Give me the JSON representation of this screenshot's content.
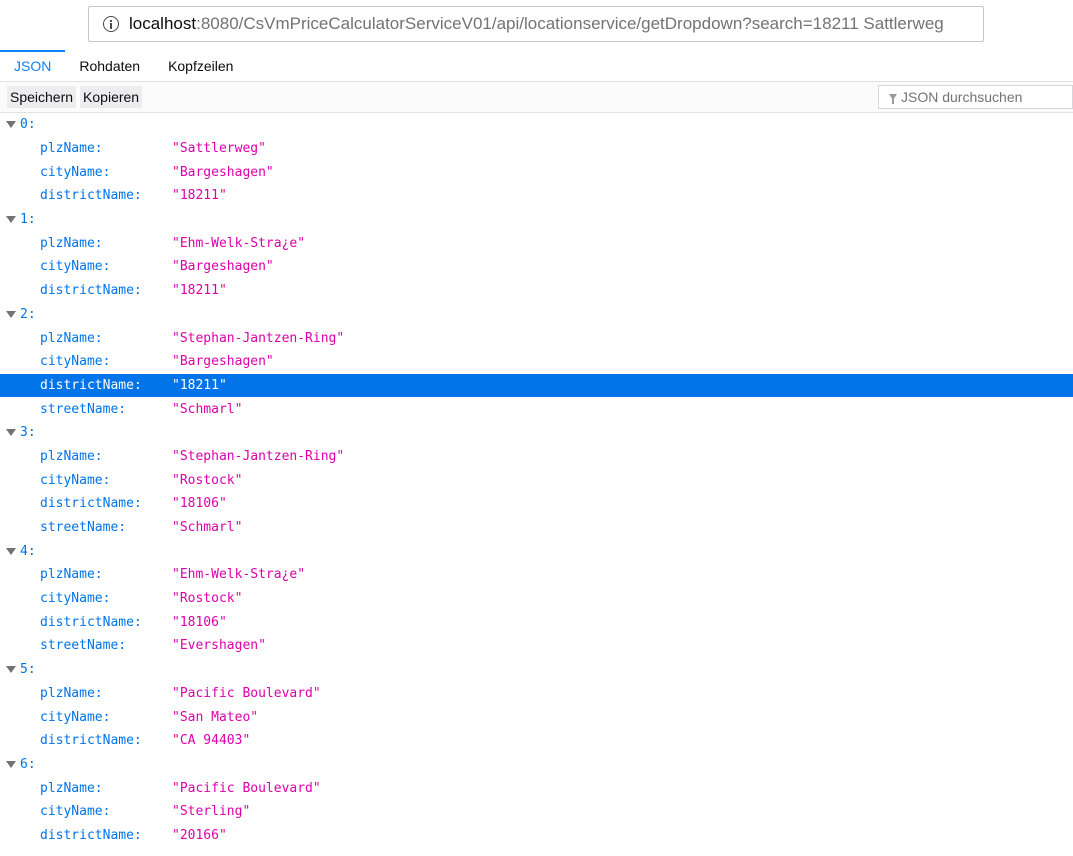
{
  "urlbar": {
    "host": "localhost",
    "rest": ":8080/CsVmPriceCalculatorServiceV01/api/locationservice/getDropdown?search=18211 Sattlerweg"
  },
  "tabs": [
    "JSON",
    "Rohdaten",
    "Kopfzeilen"
  ],
  "toolbar": {
    "save_label": "Speichern",
    "copy_label": "Kopieren",
    "filter_placeholder": "JSON durchsuchen"
  },
  "items": [
    {
      "index": "0:",
      "props": [
        {
          "key": "plzName:",
          "value": "\"Sattlerweg\""
        },
        {
          "key": "cityName:",
          "value": "\"Bargeshagen\""
        },
        {
          "key": "districtName:",
          "value": "\"18211\""
        }
      ]
    },
    {
      "index": "1:",
      "props": [
        {
          "key": "plzName:",
          "value": "\"Ehm-Welk-Stra¿e\""
        },
        {
          "key": "cityName:",
          "value": "\"Bargeshagen\""
        },
        {
          "key": "districtName:",
          "value": "\"18211\""
        }
      ]
    },
    {
      "index": "2:",
      "props": [
        {
          "key": "plzName:",
          "value": "\"Stephan-Jantzen-Ring\""
        },
        {
          "key": "cityName:",
          "value": "\"Bargeshagen\""
        },
        {
          "key": "districtName:",
          "value": "\"18211\"",
          "selected": true
        },
        {
          "key": "streetName:",
          "value": "\"Schmarl\""
        }
      ]
    },
    {
      "index": "3:",
      "props": [
        {
          "key": "plzName:",
          "value": "\"Stephan-Jantzen-Ring\""
        },
        {
          "key": "cityName:",
          "value": "\"Rostock\""
        },
        {
          "key": "districtName:",
          "value": "\"18106\""
        },
        {
          "key": "streetName:",
          "value": "\"Schmarl\""
        }
      ]
    },
    {
      "index": "4:",
      "props": [
        {
          "key": "plzName:",
          "value": "\"Ehm-Welk-Stra¿e\""
        },
        {
          "key": "cityName:",
          "value": "\"Rostock\""
        },
        {
          "key": "districtName:",
          "value": "\"18106\""
        },
        {
          "key": "streetName:",
          "value": "\"Evershagen\""
        }
      ]
    },
    {
      "index": "5:",
      "props": [
        {
          "key": "plzName:",
          "value": "\"Pacific Boulevard\""
        },
        {
          "key": "cityName:",
          "value": "\"San Mateo\""
        },
        {
          "key": "districtName:",
          "value": "\"CA 94403\""
        }
      ]
    },
    {
      "index": "6:",
      "props": [
        {
          "key": "plzName:",
          "value": "\"Pacific Boulevard\""
        },
        {
          "key": "cityName:",
          "value": "\"Sterling\""
        },
        {
          "key": "districtName:",
          "value": "\"20166\""
        }
      ]
    }
  ]
}
